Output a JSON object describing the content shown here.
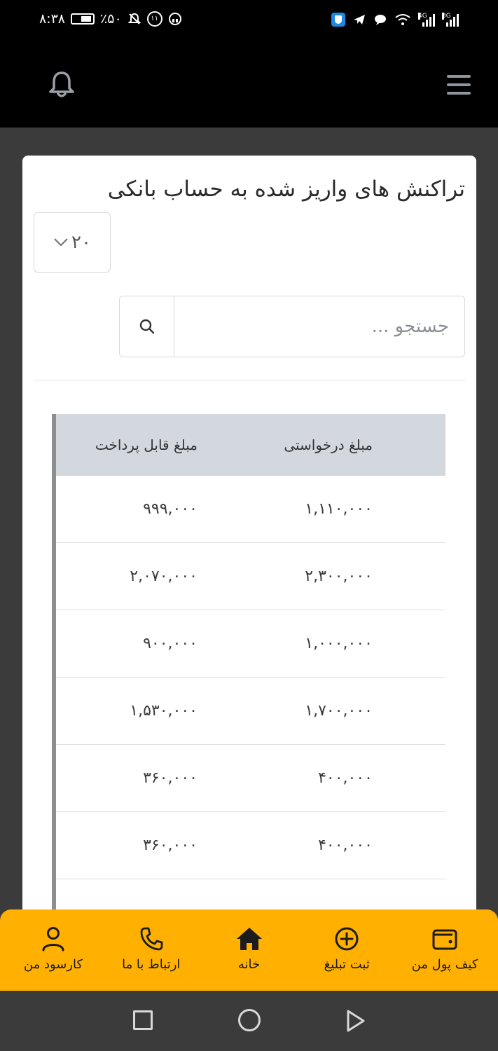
{
  "status_bar": {
    "time": "۸:۳۸",
    "battery": "٪۵۰",
    "network_left": "4G",
    "network_right": "3G"
  },
  "header": {
    "bell_icon": "bell-icon",
    "menu_icon": "menu-icon"
  },
  "card": {
    "title": "تراکنش های واریز شده به حساب بانکی",
    "page_size": "۲۰",
    "search_placeholder": "جستجو ..."
  },
  "table": {
    "columns": [
      "مبلغ درخواستی",
      "مبلغ قابل پرداخت"
    ],
    "rows": [
      {
        "requested": "۱,۱۱۰,۰۰۰",
        "payable": "۹۹۹,۰۰۰"
      },
      {
        "requested": "۲,۳۰۰,۰۰۰",
        "payable": "۲,۰۷۰,۰۰۰"
      },
      {
        "requested": "۱,۰۰۰,۰۰۰",
        "payable": "۹۰۰,۰۰۰"
      },
      {
        "requested": "۱,۷۰۰,۰۰۰",
        "payable": "۱,۵۳۰,۰۰۰"
      },
      {
        "requested": "۴۰۰,۰۰۰",
        "payable": "۳۶۰,۰۰۰"
      },
      {
        "requested": "۴۰۰,۰۰۰",
        "payable": "۳۶۰,۰۰۰"
      }
    ]
  },
  "bottom_nav": {
    "items": [
      {
        "label": "کارسود من",
        "icon": "user-icon"
      },
      {
        "label": "ارتباط با ما",
        "icon": "phone-icon"
      },
      {
        "label": "خانه",
        "icon": "home-icon"
      },
      {
        "label": "ثبت تبلیغ",
        "icon": "plus-circle-icon"
      },
      {
        "label": "کیف پول من",
        "icon": "wallet-icon"
      }
    ]
  },
  "colors": {
    "accent": "#ffb000",
    "header_bg": "#000000",
    "page_bg": "#3b3b3b",
    "table_header_bg": "#d3d8de"
  }
}
